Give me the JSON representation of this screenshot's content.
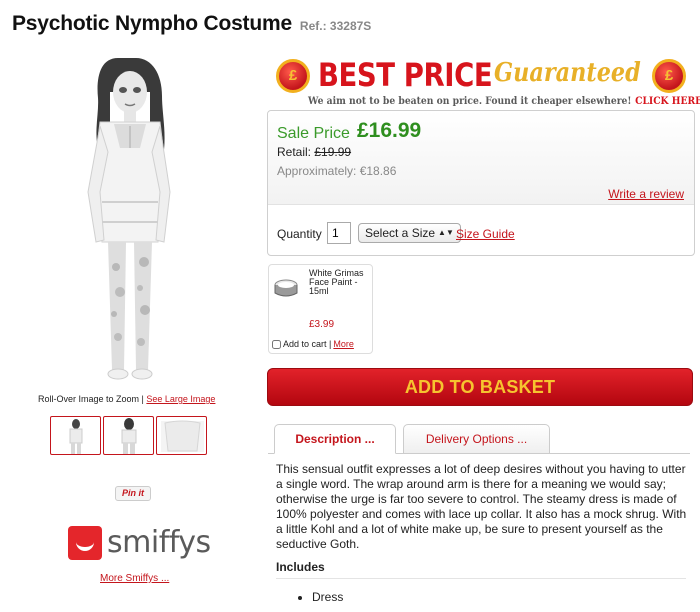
{
  "product": {
    "title": "Psychotic Nympho Costume",
    "ref": "Ref.: 33287S"
  },
  "gallery": {
    "zoom_hint": "Roll-Over Image to Zoom |",
    "large_image_link": "See Large Image",
    "pinit_label": "Pin it",
    "brand_name": "smiffys",
    "more_brand_link": "More Smiffys ..."
  },
  "banner": {
    "coin_symbol": "£",
    "headline": "BEST PRICE",
    "script_word": "Guaranteed",
    "tagline": "We aim not to be beaten on price. Found it cheaper elsewhere!",
    "cta": "CLICK HERE"
  },
  "pricing": {
    "sale_label": "Sale Price",
    "sale_price": "£16.99",
    "retail_label": "Retail:",
    "retail_price": "£19.99",
    "approx": "Approximately: €18.86",
    "review_link": "Write a review"
  },
  "options": {
    "quantity_label": "Quantity",
    "quantity_value": "1",
    "size_select": "Select a Size",
    "size_guide_link": "Size Guide"
  },
  "upsell": {
    "name": "White Grimas Face Paint - 15ml",
    "price": "£3.99",
    "add_label": "Add to cart |",
    "more_link": "More"
  },
  "basket": {
    "label": "ADD TO BASKET"
  },
  "tabs": [
    {
      "label": "Description ..."
    },
    {
      "label": "Delivery Options ..."
    }
  ],
  "description": {
    "body": "This sensual outfit expresses a lot of deep desires without you having to utter a single word. The wrap around arm is there for a meaning we would say; otherwise the urge is far too severe to control. The steamy dress is made of 100% polyester and comes with lace up collar. It also has a mock shrug. With a little Kohl and a lot of white make up, be sure to present yourself as the seductive Goth.",
    "includes_heading": "Includes",
    "includes": [
      "Dress"
    ]
  },
  "colors": {
    "accent_red": "#c4151c",
    "sale_green": "#2f8f1f",
    "button_text_gold": "#f6c42f"
  }
}
